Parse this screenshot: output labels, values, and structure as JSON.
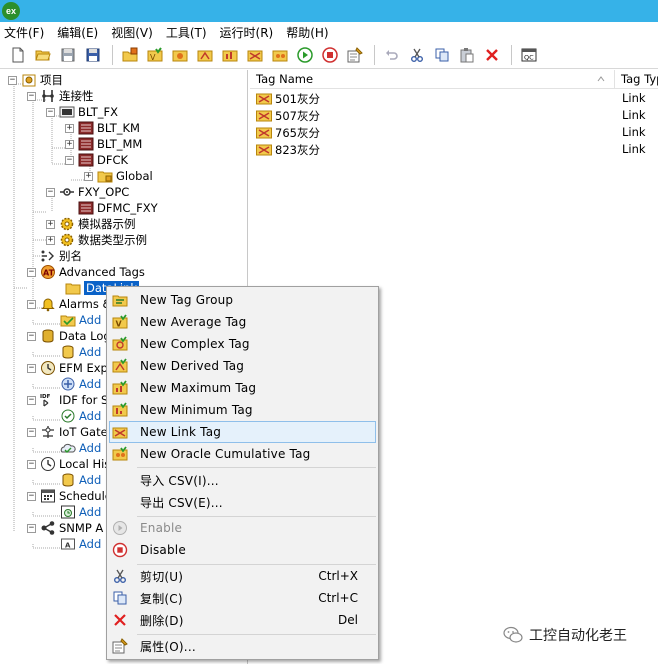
{
  "app": {
    "icon_text": "ex",
    "icon": "app-logo-icon"
  },
  "menu": [
    {
      "label": "文件(F)"
    },
    {
      "label": "编辑(E)"
    },
    {
      "label": "视图(V)"
    },
    {
      "label": "工具(T)"
    },
    {
      "label": "运行时(R)"
    },
    {
      "label": "帮助(H)"
    }
  ],
  "toolbar": {
    "icons": [
      "new-file-icon",
      "open-folder-icon",
      "save-icon",
      "save-all-icon",
      "new-channel-icon",
      "new-device-icon",
      "new-tag-group-icon",
      "new-tag-icon",
      "bulk-tags-icon",
      "new-link-icon",
      "copy-tags-icon",
      "run-icon",
      "stop-icon",
      "properties-icon",
      "undo-icon",
      "cut-icon",
      "copy-icon",
      "paste-icon",
      "delete-icon",
      "quick-client-icon"
    ],
    "quick_client_label": "QC"
  },
  "tree": {
    "project": "项目",
    "connectivity": "连接性",
    "blt_fx": "BLT_FX",
    "blt_km": "BLT_KM",
    "blt_mm": "BLT_MM",
    "dfck": "DFCK",
    "global": "Global",
    "fxy_opc": "FXY_OPC",
    "dfmc_fxy": "DFMC_FXY",
    "simulator": "模拟器示例",
    "datatype": "数据类型示例",
    "alias": "别名",
    "advanced_tags": "Advanced Tags",
    "datalink": "DataLink",
    "alarms": "Alarms &",
    "add": "Add",
    "datalog": "Data Log",
    "efm": "EFM Exp",
    "idf": "IDF for S",
    "iot": "IoT Gate",
    "local_hist": "Local His",
    "scheduler": "Schedule",
    "snmp": "SNMP A"
  },
  "list": {
    "columns": [
      "Tag Name",
      "Tag Typ"
    ],
    "rows": [
      {
        "name": "501灰分",
        "type": "Link"
      },
      {
        "name": "507灰分",
        "type": "Link"
      },
      {
        "name": "765灰分",
        "type": "Link"
      },
      {
        "name": "823灰分",
        "type": "Link"
      }
    ]
  },
  "context_menu": {
    "items": [
      {
        "label": "New Tag Group",
        "icon": "tag-group-icon",
        "shortcut": ""
      },
      {
        "label": "New Average Tag",
        "icon": "average-tag-icon",
        "shortcut": ""
      },
      {
        "label": "New Complex Tag",
        "icon": "complex-tag-icon",
        "shortcut": ""
      },
      {
        "label": "New Derived Tag",
        "icon": "derived-tag-icon",
        "shortcut": ""
      },
      {
        "label": "New Maximum Tag",
        "icon": "maximum-tag-icon",
        "shortcut": ""
      },
      {
        "label": "New Minimum Tag",
        "icon": "minimum-tag-icon",
        "shortcut": ""
      },
      {
        "label": "New Link Tag",
        "icon": "link-tag-icon",
        "shortcut": ""
      },
      {
        "label": "New Oracle Cumulative Tag",
        "icon": "oracle-tag-icon",
        "shortcut": ""
      },
      {
        "label": "导入 CSV(I)...",
        "icon": "",
        "shortcut": ""
      },
      {
        "label": "导出 CSV(E)...",
        "icon": "",
        "shortcut": ""
      },
      {
        "label": "Enable",
        "icon": "enable-icon",
        "shortcut": "",
        "disabled": true
      },
      {
        "label": "Disable",
        "icon": "disable-icon",
        "shortcut": ""
      },
      {
        "label": "剪切(U)",
        "icon": "cut-icon",
        "shortcut": "Ctrl+X"
      },
      {
        "label": "复制(C)",
        "icon": "copy-icon",
        "shortcut": "Ctrl+C"
      },
      {
        "label": "删除(D)",
        "icon": "delete-icon",
        "shortcut": "Del"
      },
      {
        "label": "属性(O)...",
        "icon": "properties-icon",
        "shortcut": ""
      }
    ],
    "hovered": "New Link Tag"
  },
  "watermark": {
    "text": "工控自动化老王",
    "icon": "wechat-icon"
  },
  "colors": {
    "titlebar": "#36b2e8",
    "selection": "#0a62c8",
    "hover_bg": "#e5f1fb",
    "hover_border": "#8fbfea",
    "blue_link": "#0f5fb8"
  }
}
